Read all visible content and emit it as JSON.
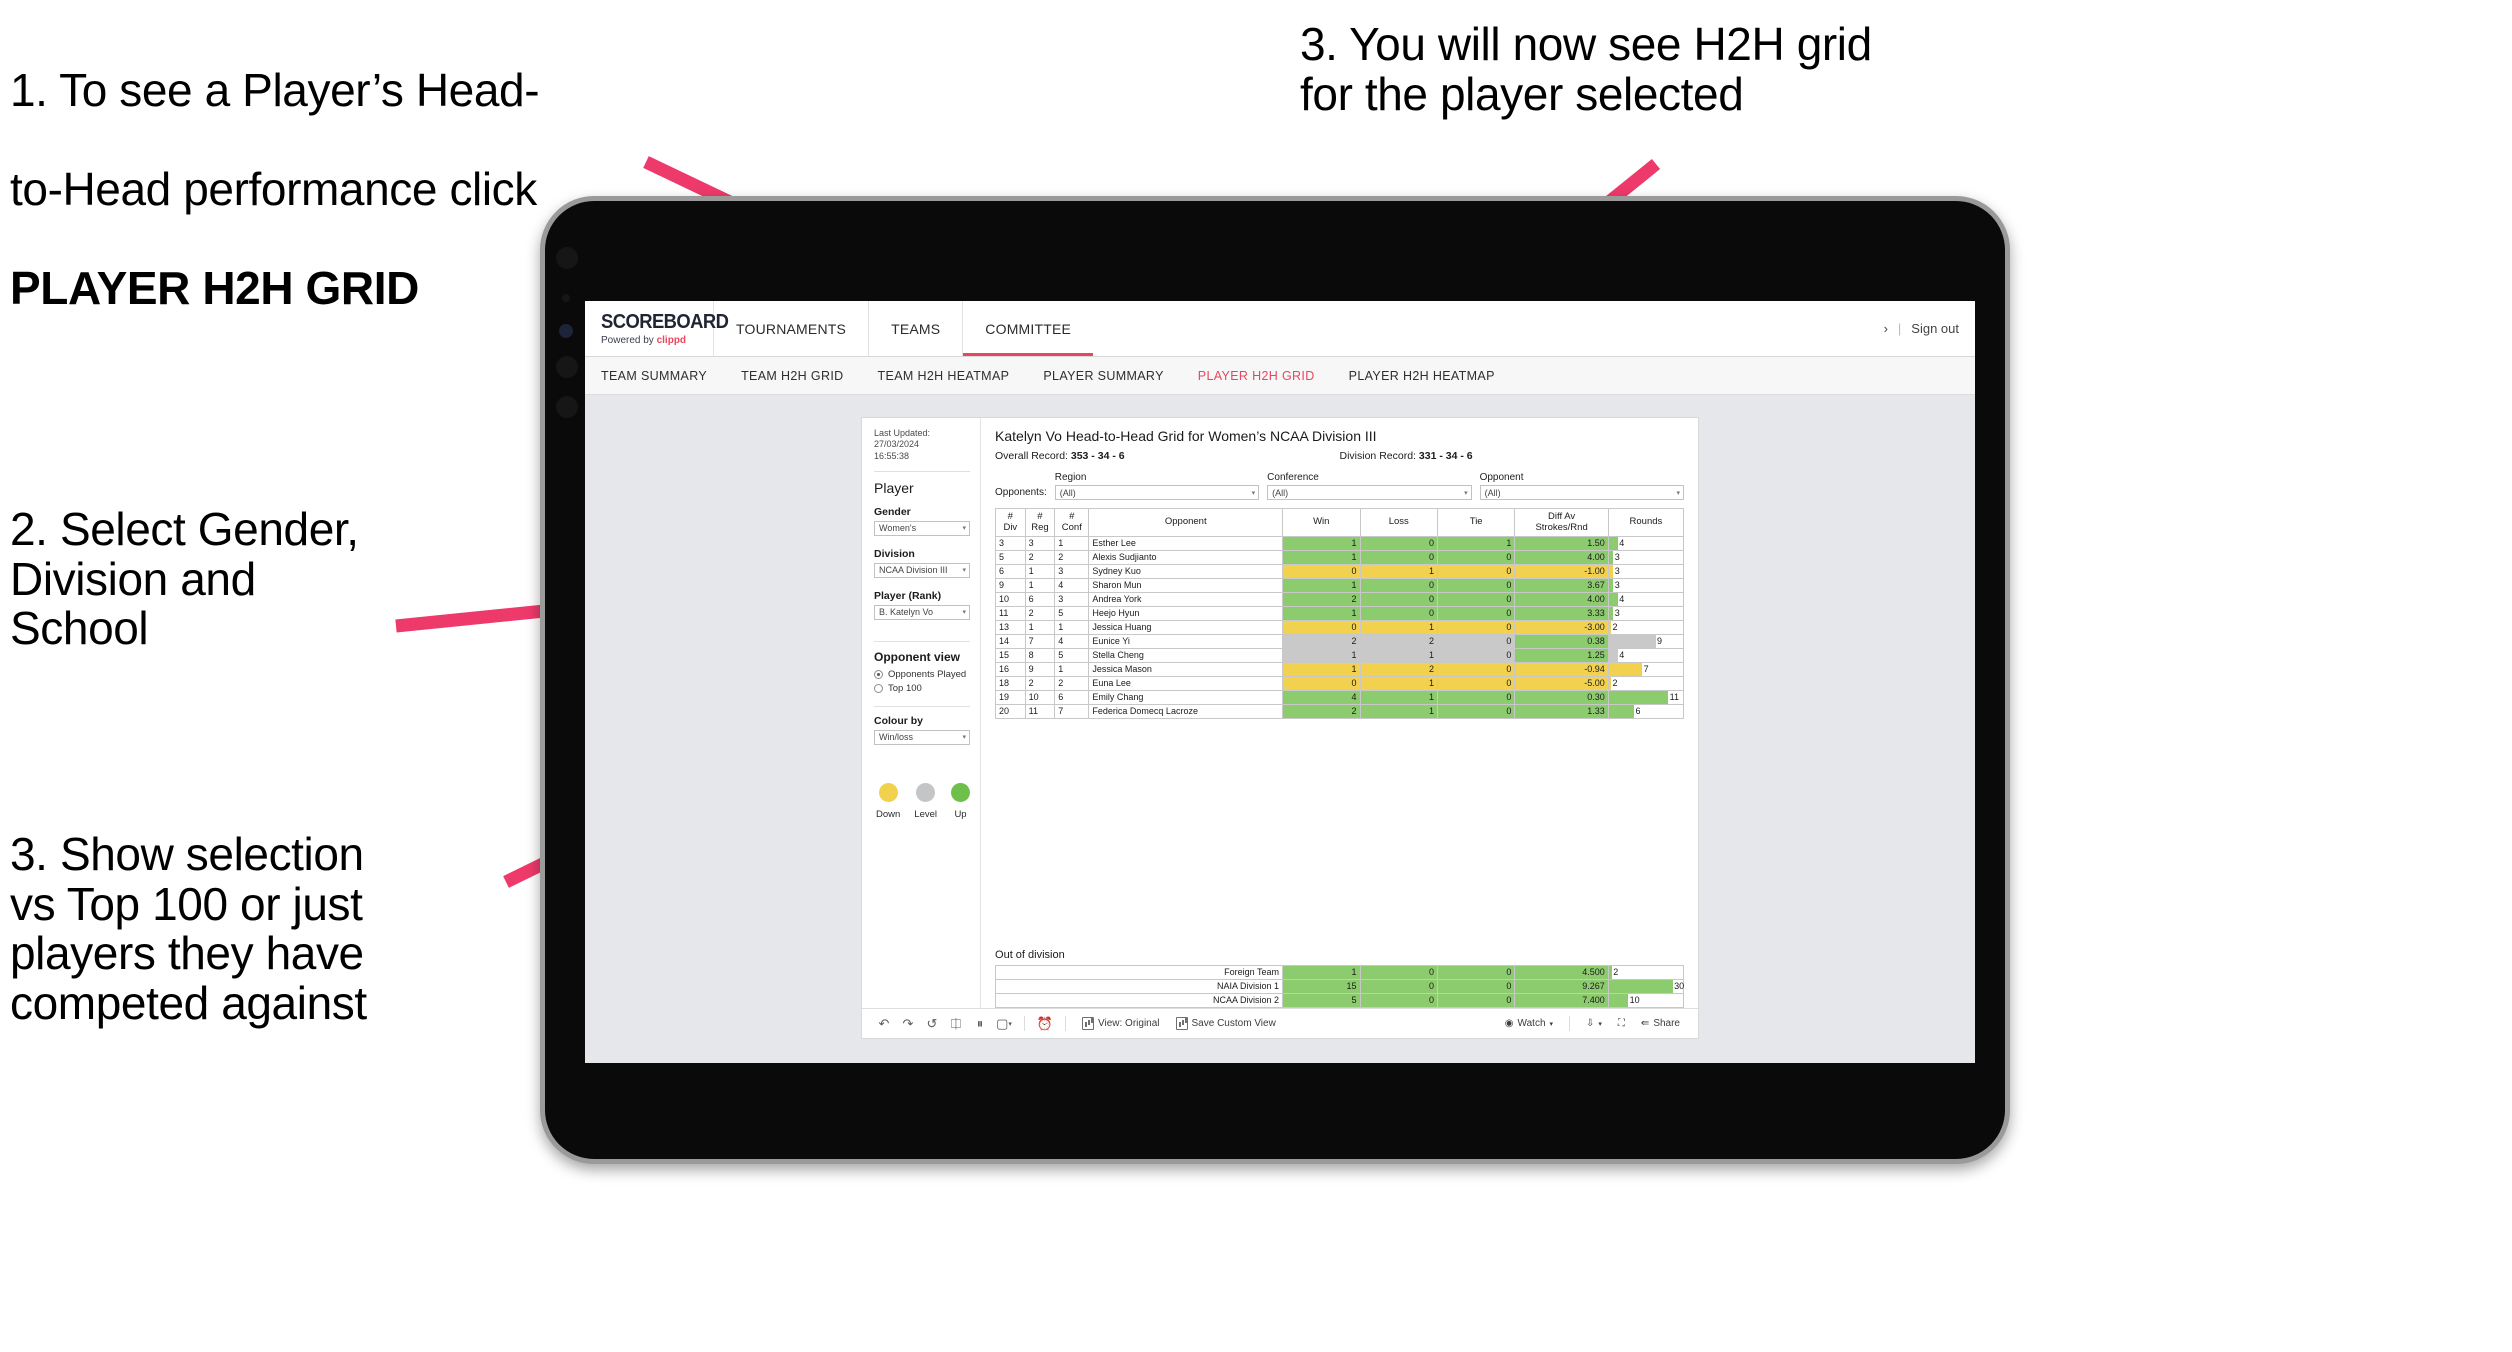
{
  "callouts": [
    {
      "id": "c1",
      "line1": "1. To see a Player’s Head-",
      "line2": "to-Head performance click",
      "line3": "PLAYER H2H GRID"
    },
    {
      "id": "c2",
      "text": "3. You will now see H2H grid\nfor the player selected"
    },
    {
      "id": "c3",
      "text": "2. Select Gender,\nDivision and\nSchool"
    },
    {
      "id": "c4",
      "text": "3. Show selection\nvs Top 100 or just\nplayers they have\ncompeted against"
    }
  ],
  "colors": {
    "accent": "#e8465f",
    "arrow": "#ee3a6b",
    "win_green": "#8ccb6e",
    "loss_yellow": "#f2d14f",
    "level_grey": "#c9c9c9",
    "bezel": "#9a9a9a"
  },
  "app": {
    "brand_name": "SCOREBOARD",
    "brand_sub_prefix": "Powered by ",
    "brand_sub_accent": "clippd",
    "nav": [
      {
        "label": "TOURNAMENTS",
        "active": false
      },
      {
        "label": "TEAMS",
        "active": false
      },
      {
        "label": "COMMITTEE",
        "active": true
      }
    ],
    "account_glyph": "›",
    "separator": "|",
    "sign_out": "Sign out",
    "tabs": [
      {
        "label": "TEAM SUMMARY",
        "active": false
      },
      {
        "label": "TEAM H2H GRID",
        "active": false
      },
      {
        "label": "TEAM H2H HEATMAP",
        "active": false
      },
      {
        "label": "PLAYER SUMMARY",
        "active": false
      },
      {
        "label": "PLAYER H2H GRID",
        "active": true
      },
      {
        "label": "PLAYER H2H HEATMAP",
        "active": false
      }
    ]
  },
  "rail": {
    "updated_line1": "Last Updated: 27/03/2024",
    "updated_line2": "16:55:38",
    "section_player": "Player",
    "fields": [
      {
        "label": "Gender",
        "value": "Women's"
      },
      {
        "label": "Division",
        "value": "NCAA Division III"
      },
      {
        "label": "Player (Rank)",
        "value": "B. Katelyn Vo"
      }
    ],
    "opponent_view_title": "Opponent view",
    "opponent_view_options": [
      {
        "label": "Opponents Played",
        "selected": true
      },
      {
        "label": "Top 100",
        "selected": false
      }
    ],
    "colour_by_label": "Colour by",
    "colour_by_value": "Win/loss",
    "legend": [
      {
        "label": "Down",
        "color": "#f2d14f"
      },
      {
        "label": "Level",
        "color": "#c3c5c7"
      },
      {
        "label": "Up",
        "color": "#6fc04a"
      }
    ]
  },
  "viz": {
    "title": "Katelyn Vo Head-to-Head Grid for Women’s NCAA Division III",
    "overall_record_label": "Overall Record: ",
    "overall_record_value": "353 - 34 - 6",
    "division_record_label": "Division Record: ",
    "division_record_value": "331 - 34 - 6",
    "opponents_label": "Opponents:",
    "filters": [
      {
        "caption": "Region",
        "value": "(All)"
      },
      {
        "caption": "Conference",
        "value": "(All)"
      },
      {
        "caption": "Opponent",
        "value": "(All)"
      }
    ],
    "columns": [
      {
        "l1": "#",
        "l2": "Div"
      },
      {
        "l1": "#",
        "l2": "Reg"
      },
      {
        "l1": "#",
        "l2": "Conf"
      },
      {
        "l1": "Opponent",
        "l2": ""
      },
      {
        "l1": "Win",
        "l2": ""
      },
      {
        "l1": "Loss",
        "l2": ""
      },
      {
        "l1": "Tie",
        "l2": ""
      },
      {
        "l1": "Diff Av",
        "l2": "Strokes/Rnd"
      },
      {
        "l1": "Rounds",
        "l2": ""
      }
    ],
    "rows": [
      {
        "div": "3",
        "reg": "3",
        "conf": "1",
        "opponent": "Esther Lee",
        "win": "1",
        "loss": "0",
        "tie": "1",
        "diff": "1.50",
        "rounds": "4",
        "fill": "#8ccb6e",
        "bar_pct": 12
      },
      {
        "div": "5",
        "reg": "2",
        "conf": "2",
        "opponent": "Alexis Sudjianto",
        "win": "1",
        "loss": "0",
        "tie": "0",
        "diff": "4.00",
        "rounds": "3",
        "fill": "#8ccb6e",
        "bar_pct": 6
      },
      {
        "div": "6",
        "reg": "1",
        "conf": "3",
        "opponent": "Sydney Kuo",
        "win": "0",
        "loss": "1",
        "tie": "0",
        "diff": "-1.00",
        "rounds": "3",
        "fill": "#f2d14f",
        "bar_pct": 6
      },
      {
        "div": "9",
        "reg": "1",
        "conf": "4",
        "opponent": "Sharon Mun",
        "win": "1",
        "loss": "0",
        "tie": "0",
        "diff": "3.67",
        "rounds": "3",
        "fill": "#8ccb6e",
        "bar_pct": 6
      },
      {
        "div": "10",
        "reg": "6",
        "conf": "3",
        "opponent": "Andrea York",
        "win": "2",
        "loss": "0",
        "tie": "0",
        "diff": "4.00",
        "rounds": "4",
        "fill": "#8ccb6e",
        "bar_pct": 12
      },
      {
        "div": "11",
        "reg": "2",
        "conf": "5",
        "opponent": "Heejo Hyun",
        "win": "1",
        "loss": "0",
        "tie": "0",
        "diff": "3.33",
        "rounds": "3",
        "fill": "#8ccb6e",
        "bar_pct": 6
      },
      {
        "div": "13",
        "reg": "1",
        "conf": "1",
        "opponent": "Jessica Huang",
        "win": "0",
        "loss": "1",
        "tie": "0",
        "diff": "-3.00",
        "rounds": "2",
        "fill": "#f2d14f",
        "bar_pct": 3
      },
      {
        "div": "14",
        "reg": "7",
        "conf": "4",
        "opponent": "Eunice Yi",
        "win": "2",
        "loss": "2",
        "tie": "0",
        "diff": "0.38",
        "rounds": "9",
        "fill": "#c9c9c9",
        "diff_fill": "#8ccb6e",
        "bar_pct": 63
      },
      {
        "div": "15",
        "reg": "8",
        "conf": "5",
        "opponent": "Stella Cheng",
        "win": "1",
        "loss": "1",
        "tie": "0",
        "diff": "1.25",
        "rounds": "4",
        "fill": "#c9c9c9",
        "diff_fill": "#8ccb6e",
        "bar_pct": 12
      },
      {
        "div": "16",
        "reg": "9",
        "conf": "1",
        "opponent": "Jessica Mason",
        "win": "1",
        "loss": "2",
        "tie": "0",
        "diff": "-0.94",
        "rounds": "7",
        "fill": "#f2d14f",
        "bar_pct": 45
      },
      {
        "div": "18",
        "reg": "2",
        "conf": "2",
        "opponent": "Euna Lee",
        "win": "0",
        "loss": "1",
        "tie": "0",
        "diff": "-5.00",
        "rounds": "2",
        "fill": "#f2d14f",
        "bar_pct": 3
      },
      {
        "div": "19",
        "reg": "10",
        "conf": "6",
        "opponent": "Emily Chang",
        "win": "4",
        "loss": "1",
        "tie": "0",
        "diff": "0.30",
        "rounds": "11",
        "fill": "#8ccb6e",
        "bar_pct": 80
      },
      {
        "div": "20",
        "reg": "11",
        "conf": "7",
        "opponent": "Federica Domecq Lacroze",
        "win": "2",
        "loss": "1",
        "tie": "0",
        "diff": "1.33",
        "rounds": "6",
        "fill": "#8ccb6e",
        "bar_pct": 34
      }
    ],
    "out_of_division_title": "Out of division",
    "out_of_division_rows": [
      {
        "opponent": "Foreign Team",
        "win": "1",
        "loss": "0",
        "tie": "0",
        "diff": "4.500",
        "rounds": "2",
        "fill": "#8ccb6e",
        "bar_pct": 4
      },
      {
        "opponent": "NAIA Division 1",
        "win": "15",
        "loss": "0",
        "tie": "0",
        "diff": "9.267",
        "rounds": "30",
        "fill": "#8ccb6e",
        "bar_pct": 86
      },
      {
        "opponent": "NCAA Division 2",
        "win": "5",
        "loss": "0",
        "tie": "0",
        "diff": "7.400",
        "rounds": "10",
        "fill": "#8ccb6e",
        "bar_pct": 26
      }
    ],
    "toolbar": {
      "icons": [
        "undo-icon",
        "redo-icon",
        "revert-icon",
        "refresh-icon",
        "pause-icon",
        "zoom-icon",
        "alert-icon"
      ],
      "view_original": "View: Original",
      "save_custom_view": "Save Custom View",
      "watch": "Watch",
      "share": "Share",
      "caret": "▾"
    }
  }
}
